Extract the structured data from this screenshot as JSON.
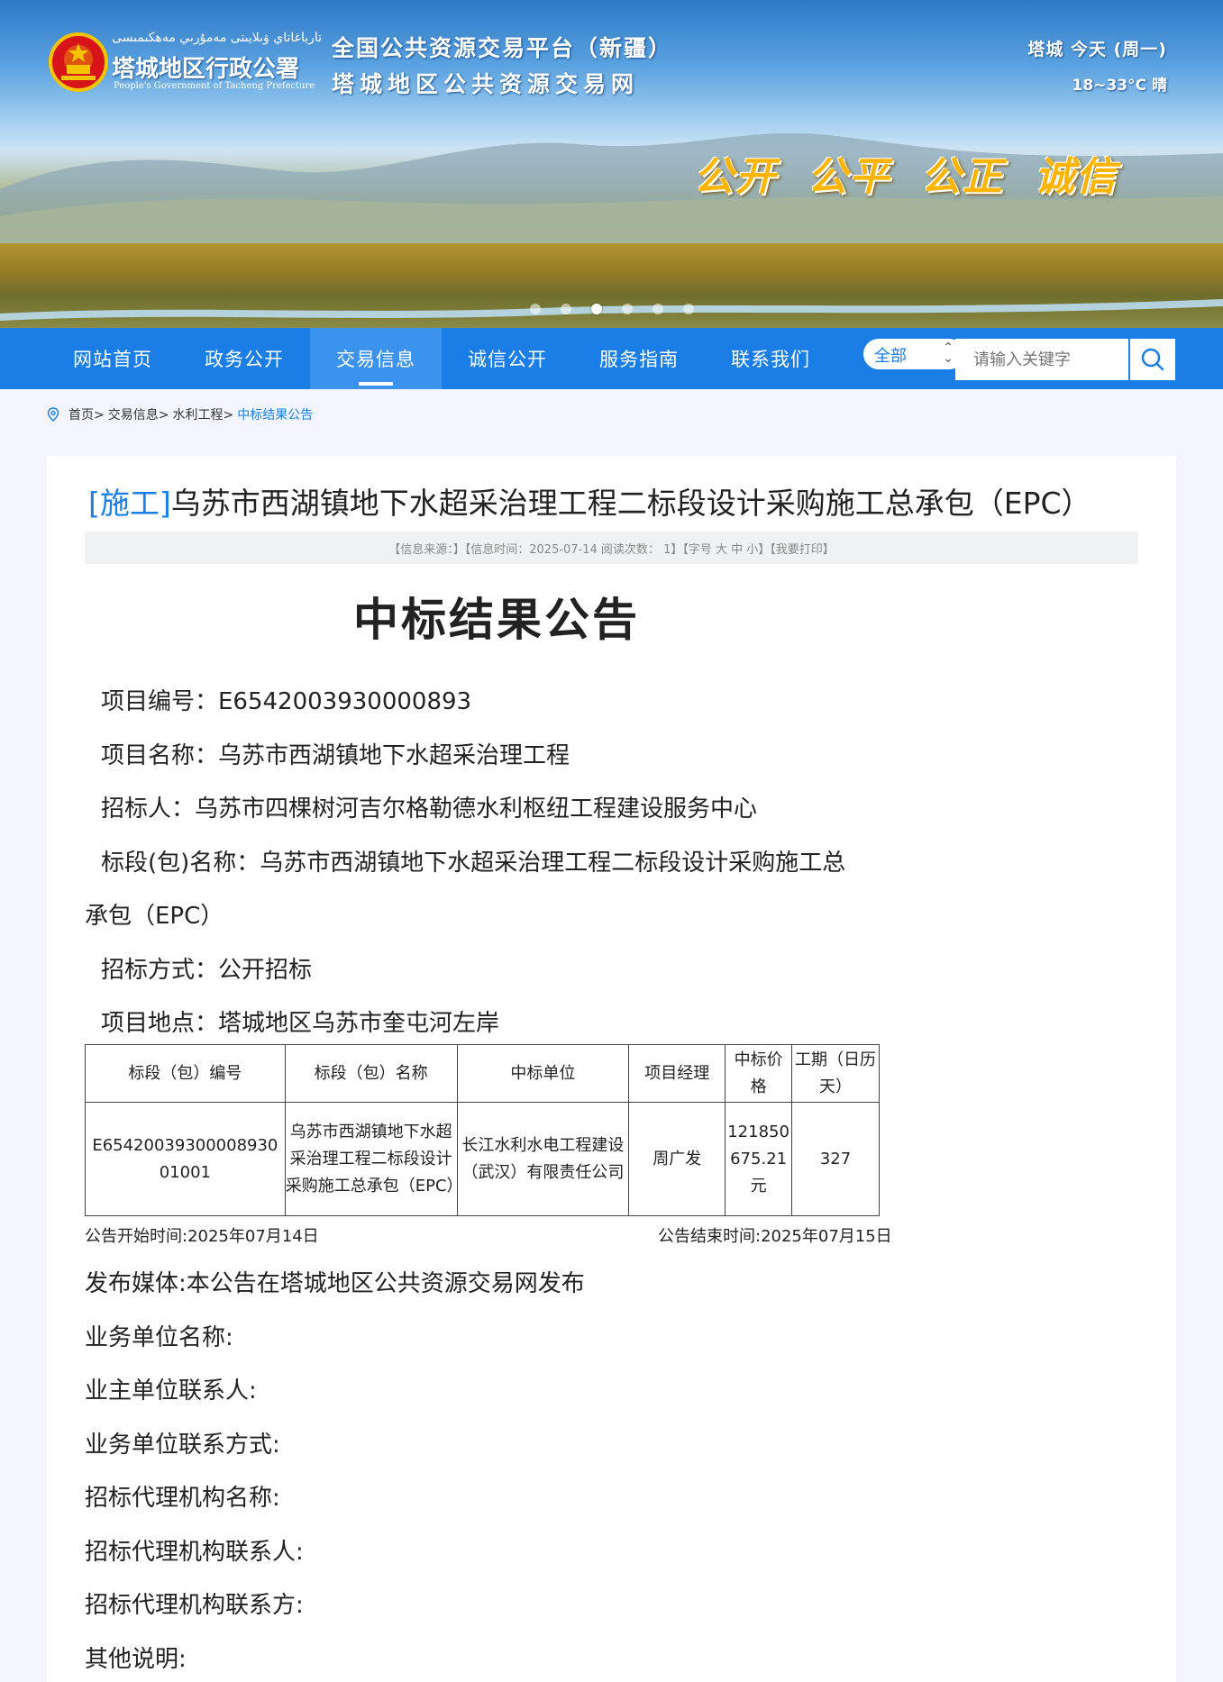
{
  "header": {
    "gov_uyghur": "تارباغاتاي ۋىلايىتى مەمۇرىي مەھكىمىسى",
    "gov_name": "塔城地区行政公署",
    "gov_english": "People's Government of Tacheng Prefecture",
    "site_title_1": "全国公共资源交易平台（新疆）",
    "site_title_2": "塔城地区公共资源交易网",
    "weather_line_1": "塔城  今天 (周一)",
    "weather_line_2": "18~33°C 晴",
    "slogan": [
      "公开",
      "公平",
      "公正",
      "诚信"
    ],
    "carousel": {
      "count": 6,
      "active_index": 2
    },
    "colors": {
      "nav": "#1a7ee6",
      "slogan": "#ffb400"
    }
  },
  "nav": {
    "items": [
      {
        "label": "网站首页",
        "active": false
      },
      {
        "label": "政务公开",
        "active": false
      },
      {
        "label": "交易信息",
        "active": true
      },
      {
        "label": "诚信公开",
        "active": false
      },
      {
        "label": "服务指南",
        "active": false
      },
      {
        "label": "联系我们",
        "active": false
      }
    ],
    "search": {
      "scope": "全部",
      "placeholder": "请输入关键字",
      "icon": "search-icon"
    }
  },
  "breadcrumb": {
    "icon": "location-pin-icon",
    "items": [
      "首页>",
      "交易信息>",
      "水利工程>"
    ],
    "current": "中标结果公告"
  },
  "article": {
    "category": "[施工]",
    "title": "乌苏市西湖镇地下水超采治理工程二标段设计采购施工总承包（EPC）",
    "meta": "【信息来源：】【信息时间：2025-07-14   阅读次数：  1】【字号 大 中 小】【我要打印】",
    "doc_title": "中标结果公告",
    "fields": {
      "project_no": "项目编号：E6542003930000893",
      "project_name": "项目名称：乌苏市西湖镇地下水超采治理工程",
      "tenderer": "招标人：乌苏市四棵树河吉尔格勒德水利枢纽工程建设服务中心",
      "section_name_1": "标段(包)名称：乌苏市西湖镇地下水超采治理工程二标段设计采购施工总",
      "section_name_2": "承包（EPC）",
      "method": "招标方式：公开招标",
      "location": "项目地点：塔城地区乌苏市奎屯河左岸"
    },
    "table": {
      "headers": [
        "标段（包）编号",
        "标段（包）名称",
        "中标单位",
        "项目经理",
        "中标价格",
        "工期（日历天）"
      ],
      "rows": [
        [
          "E6542003930000893001001",
          "乌苏市西湖镇地下水超采治理工程二标段设计采购施工总承包（EPC）",
          "长江水利水电工程建设（武汉）有限责任公司",
          "周广发",
          "121850675.21元",
          "327"
        ]
      ]
    },
    "notice_start": "公告开始时间:2025年07月14日",
    "notice_end": "公告结束时间:2025年07月15日",
    "footer_lines": [
      "发布媒体:本公告在塔城地区公共资源交易网发布",
      "业务单位名称:",
      "业主单位联系人:",
      "业务单位联系方式:",
      "招标代理机构名称:",
      "招标代理机构联系人:",
      "招标代理机构联系方:",
      "其他说明:"
    ]
  }
}
